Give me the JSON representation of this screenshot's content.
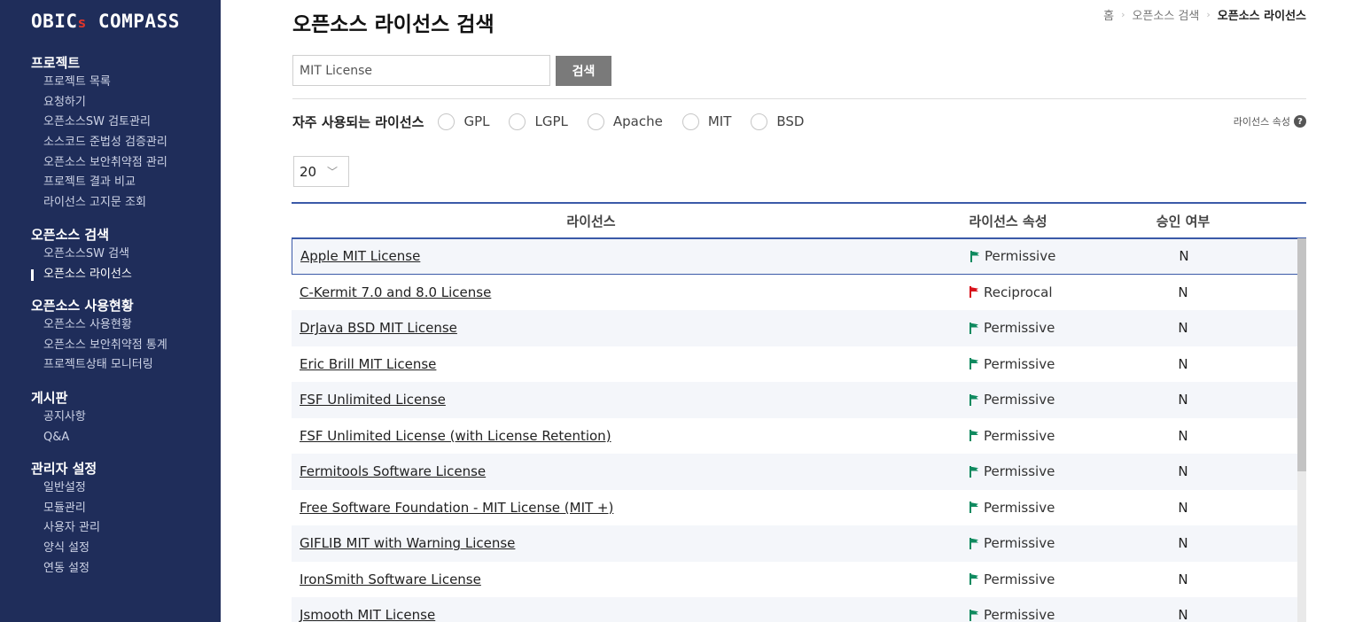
{
  "app": {
    "logo_main": "OBIC",
    "logo_accent": "s",
    "logo_rest": " COMPASS"
  },
  "sidebar": {
    "sections": [
      {
        "title": "프로젝트",
        "items": [
          "프로젝트 목록",
          "요청하기",
          "오픈소스SW 검토관리",
          "소스코드 준법성 검증관리",
          "오픈소스 보안취약점 관리",
          "프로젝트 결과 비교",
          "라이선스 고지문 조회"
        ]
      },
      {
        "title": "오픈소스 검색",
        "items": [
          "오픈소스SW 검색",
          "오픈소스 라이선스"
        ]
      },
      {
        "title": "오픈소스 사용현황",
        "items": [
          "오픈소스 사용현황",
          "오픈소스 보안취약점 통계",
          "프로젝트상태 모니터링"
        ]
      },
      {
        "title": "게시판",
        "items": [
          "공지사항",
          "Q&A"
        ]
      },
      {
        "title": "관리자 설정",
        "items": [
          "일반설정",
          "모듈관리",
          "사용자 관리",
          "양식 설정",
          "연동 설정"
        ]
      }
    ]
  },
  "header": {
    "title": "오픈소스 라이선스 검색",
    "breadcrumb": [
      "홈",
      "오픈소스 검색",
      "오픈소스 라이선스"
    ]
  },
  "search": {
    "value": "MIT License",
    "button_label": "검색"
  },
  "filter": {
    "label": "자주 사용되는 라이선스",
    "options": [
      "GPL",
      "LGPL",
      "Apache",
      "MIT",
      "BSD"
    ],
    "attr_link": "라이선스 속성",
    "help_glyph": "?"
  },
  "page_size": {
    "value": "20",
    "chevron": "﹀"
  },
  "table": {
    "headers": [
      "라이선스",
      "라이선스 속성",
      "승인 여부"
    ],
    "colors": {
      "Permissive": "#0f8a5f",
      "Reciprocal": "#d8121b"
    },
    "rows": [
      {
        "name": "Apple MIT License",
        "attr": "Permissive",
        "approved": "N"
      },
      {
        "name": "C-Kermit 7.0 and 8.0 License",
        "attr": "Reciprocal",
        "approved": "N"
      },
      {
        "name": "DrJava BSD MIT License",
        "attr": "Permissive",
        "approved": "N"
      },
      {
        "name": "Eric Brill MIT License",
        "attr": "Permissive",
        "approved": "N"
      },
      {
        "name": "FSF Unlimited License",
        "attr": "Permissive",
        "approved": "N"
      },
      {
        "name": "FSF Unlimited License (with License Retention)",
        "attr": "Permissive",
        "approved": "N"
      },
      {
        "name": "Fermitools Software License",
        "attr": "Permissive",
        "approved": "N"
      },
      {
        "name": "Free Software Foundation - MIT License (MIT +)",
        "attr": "Permissive",
        "approved": "N"
      },
      {
        "name": "GIFLIB MIT with Warning License",
        "attr": "Permissive",
        "approved": "N"
      },
      {
        "name": "IronSmith Software License",
        "attr": "Permissive",
        "approved": "N"
      },
      {
        "name": "Jsmooth MIT License",
        "attr": "Permissive",
        "approved": "N"
      }
    ]
  }
}
